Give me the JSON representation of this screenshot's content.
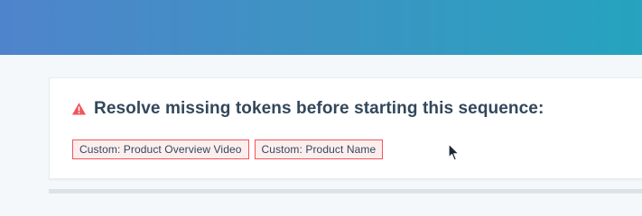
{
  "header": {
    "background_start": "#4f84cc",
    "background_end": "#25a3bf"
  },
  "alert": {
    "title": "Resolve missing tokens before starting this sequence:",
    "icon": "warning-icon",
    "accent_color": "#f2545b",
    "tokens": [
      "Custom: Product Overview Video",
      "Custom: Product Name"
    ]
  },
  "cursor": {
    "icon": "arrow-cursor-icon"
  }
}
